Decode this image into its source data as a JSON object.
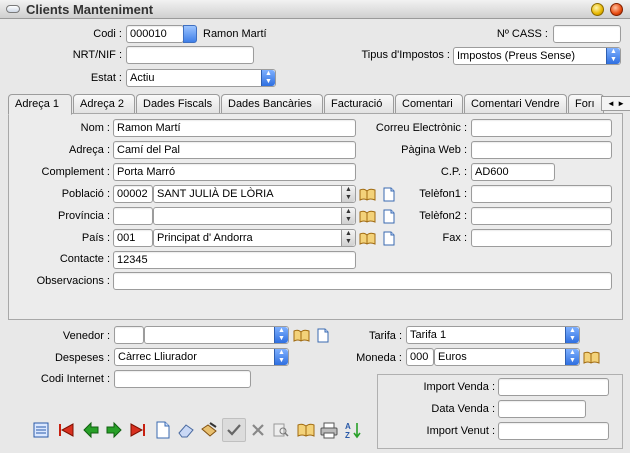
{
  "window": {
    "title": "Clients Manteniment"
  },
  "header": {
    "codi_label": "Codi :",
    "codi_value": "000010",
    "client_name": "Ramon Martí",
    "cass_label": "Nº CASS :",
    "cass_value": "",
    "nrt_label": "NRT/NIF :",
    "nrt_value": "",
    "tipus_label": "Tipus d'Impostos :",
    "tipus_value": "Impostos (Preus Sense)",
    "estat_label": "Estat :",
    "estat_value": "Actiu"
  },
  "tabs": [
    {
      "label": "Adreça 1"
    },
    {
      "label": "Adreça 2"
    },
    {
      "label": "Dades Fiscals"
    },
    {
      "label": "Dades Bancàries"
    },
    {
      "label": "Facturació"
    },
    {
      "label": "Comentari"
    },
    {
      "label": "Comentari Vendre"
    },
    {
      "label": "Forı"
    }
  ],
  "tab_nav": {
    "prev": "◄",
    "next": "►"
  },
  "address": {
    "nom_label": "Nom :",
    "nom_value": "Ramon Martí",
    "adreca_label": "Adreça :",
    "adreca_value": "Camí del Pal",
    "complement_label": "Complement :",
    "complement_value": "Porta Marró",
    "poblacio_label": "Població :",
    "poblacio_code": "00002",
    "poblacio_name": "SANT JULIÀ DE LÒRIA",
    "provincia_label": "Província :",
    "provincia_code": "",
    "provincia_name": "",
    "pais_label": "País :",
    "pais_code": "001",
    "pais_name": "Principat d' Andorra",
    "contacte_label": "Contacte :",
    "contacte_value": "12345",
    "observacions_label": "Observacions :",
    "observacions_value": "",
    "correu_label": "Correu Electrònic :",
    "correu_value": "",
    "web_label": "Pàgina Web :",
    "web_value": "",
    "cp_label": "C.P. :",
    "cp_value": "AD600",
    "tel1_label": "Telèfon1 :",
    "tel1_value": "",
    "tel2_label": "Telèfon2 :",
    "tel2_value": "",
    "fax_label": "Fax :",
    "fax_value": ""
  },
  "footer": {
    "venedor_label": "Venedor :",
    "venedor_code": "",
    "venedor_name": "",
    "despeses_label": "Despeses :",
    "despeses_value": "Càrrec Lliurador",
    "codi_internet_label": "Codi Internet :",
    "codi_internet_value": "",
    "tarifa_label": "Tarifa :",
    "tarifa_value": "Tarifa 1",
    "moneda_label": "Moneda :",
    "moneda_code": "000",
    "moneda_name": "Euros",
    "import_venda_label": "Import Venda :",
    "import_venda_value": "",
    "data_venda_label": "Data Venda :",
    "data_venda_value": "",
    "import_venut_label": "Import Venut :",
    "import_venut_value": ""
  },
  "toolbar": {
    "icons": [
      "list-icon",
      "first-record-icon",
      "previous-record-icon",
      "next-record-icon",
      "last-record-icon",
      "new-record-icon",
      "erase-icon",
      "edit-icon",
      "accept-icon",
      "cancel-icon",
      "search-icon",
      "browse-book-icon",
      "print-icon",
      "sort-az-icon"
    ]
  },
  "colors": {
    "accent_blue": "#2f6fe0",
    "background": "#e8e8e8",
    "nav_red": "#d83020",
    "nav_green": "#28a028"
  }
}
